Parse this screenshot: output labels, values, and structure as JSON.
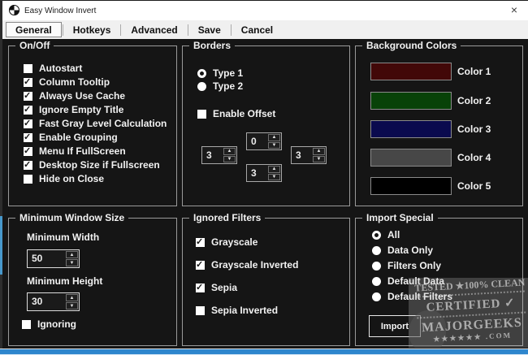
{
  "window": {
    "title": "Easy Window Invert",
    "close_glyph": "×"
  },
  "tabs": [
    {
      "label": "General",
      "selected": true
    },
    {
      "label": "Hotkeys",
      "selected": false
    },
    {
      "label": "Advanced",
      "selected": false
    },
    {
      "label": "Save",
      "selected": false
    },
    {
      "label": "Cancel",
      "selected": false
    }
  ],
  "groups": {
    "on_off": {
      "title": "On/Off",
      "items": [
        {
          "label": "Autostart",
          "checked": false
        },
        {
          "label": "Column Tooltip",
          "checked": true
        },
        {
          "label": "Always Use Cache",
          "checked": true
        },
        {
          "label": "Ignore Empty Title",
          "checked": true
        },
        {
          "label": "Fast Gray Level Calculation",
          "checked": true
        },
        {
          "label": "Enable Grouping",
          "checked": true
        },
        {
          "label": "Menu If FullScreen",
          "checked": true
        },
        {
          "label": "Desktop Size if Fullscreen",
          "checked": true
        },
        {
          "label": "Hide on Close",
          "checked": false
        }
      ]
    },
    "borders": {
      "title": "Borders",
      "radios": [
        {
          "label": "Type 1",
          "selected": true
        },
        {
          "label": "Type 2",
          "selected": false
        }
      ],
      "offset": {
        "label": "Enable Offset",
        "checked": false
      },
      "spinners": {
        "top": "0",
        "left": "3",
        "right": "3",
        "bottom": "3"
      }
    },
    "background_colors": {
      "title": "Background Colors",
      "items": [
        {
          "label": "Color 1",
          "color": "#420808"
        },
        {
          "label": "Color 2",
          "color": "#084208"
        },
        {
          "label": "Color 3",
          "color": "#0a0a4e"
        },
        {
          "label": "Color 4",
          "color": "#474747"
        },
        {
          "label": "Color 5",
          "color": "#000000"
        }
      ]
    },
    "minimum_window_size": {
      "title": "Minimum Window Size",
      "width_label": "Minimum Width",
      "width_value": "50",
      "height_label": "Minimum Height",
      "height_value": "30",
      "ignoring": {
        "label": "Ignoring",
        "checked": false
      }
    },
    "ignored_filters": {
      "title": "Ignored Filters",
      "items": [
        {
          "label": "Grayscale",
          "checked": true
        },
        {
          "label": "Grayscale Inverted",
          "checked": true
        },
        {
          "label": "Sepia",
          "checked": true
        },
        {
          "label": "Sepia Inverted",
          "checked": false
        }
      ]
    },
    "import_special": {
      "title": "Import Special",
      "radios": [
        {
          "label": "All",
          "selected": true
        },
        {
          "label": "Data Only",
          "selected": false
        },
        {
          "label": "Filters Only",
          "selected": false
        },
        {
          "label": "Default Data",
          "selected": false
        },
        {
          "label": "Default Filters",
          "selected": false
        }
      ],
      "import_button": "Import"
    }
  },
  "watermark": {
    "line1": "TESTED ★100% CLEAN",
    "line2": "CERTIFIED ✓",
    "line3": "MAJORGEEKS",
    "line4": "★★★★★★ .COM"
  }
}
